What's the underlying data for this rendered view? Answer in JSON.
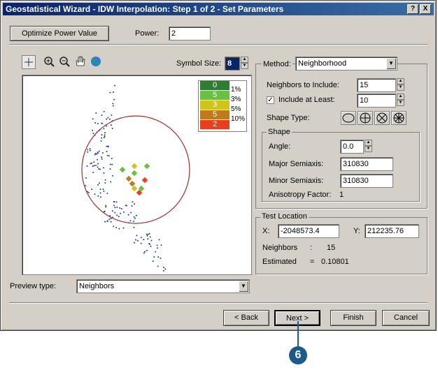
{
  "window": {
    "title": "Geostatistical Wizard - IDW Interpolation: Step 1 of 2 - Set Parameters",
    "help_btn": "?",
    "close_btn": "X"
  },
  "top": {
    "optimize_label": "Optimize Power Value",
    "power_label": "Power:",
    "power_value": "2"
  },
  "preview": {
    "symbol_size_label": "Symbol Size:",
    "symbol_size_value": "8",
    "preview_type_label": "Preview type:",
    "preview_type_value": "Neighbors"
  },
  "legend": [
    {
      "count": "0",
      "pct": "1%",
      "color": "#2e7d32"
    },
    {
      "count": "5",
      "pct": "3%",
      "color": "#6abf45"
    },
    {
      "count": "3",
      "pct": "5%",
      "color": "#d4c21a"
    },
    {
      "count": "5",
      "pct": "10%",
      "color": "#c07a1e"
    },
    {
      "count": "2",
      "pct": "",
      "color": "#e8401c"
    }
  ],
  "method": {
    "label": "Method:",
    "value": "Neighborhood",
    "neighbors_label": "Neighbors to Include:",
    "neighbors_value": "15",
    "include_label": "Include at Least:",
    "include_value": "10",
    "shape_type_label": "Shape Type:"
  },
  "shape": {
    "title": "Shape",
    "angle_label": "Angle:",
    "angle_value": "0.0",
    "major_label": "Major Semiaxis:",
    "major_value": "310830",
    "minor_label": "Minor Semiaxis:",
    "minor_value": "310830",
    "aniso_label": "Anisotropy Factor:",
    "aniso_value": "1"
  },
  "test": {
    "title": "Test Location",
    "x_label": "X:",
    "x_value": "-2048573.4",
    "y_label": "Y:",
    "y_value": "212235.76",
    "neighbors_label": "Neighbors",
    "neighbors_sep": ":",
    "neighbors_value": "15",
    "estimated_label": "Estimated",
    "estimated_sep": "=",
    "estimated_value": "0.10801"
  },
  "footer": {
    "back": "< Back",
    "next": "Next >",
    "finish": "Finish",
    "cancel": "Cancel"
  },
  "callout": {
    "number": "6",
    "color": "#1c5a8a"
  }
}
